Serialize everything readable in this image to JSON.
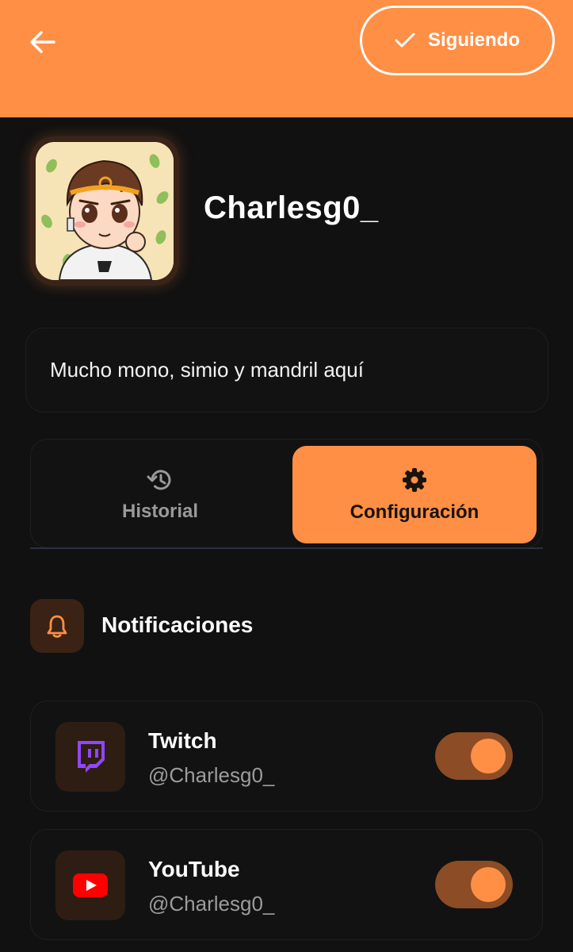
{
  "header": {
    "follow_label": "Siguiendo",
    "accent_color": "#ff8f45",
    "back_icon": "arrow-left-icon",
    "check_icon": "check-icon"
  },
  "profile": {
    "username": "Charlesg0_",
    "bio": "Mucho mono, simio y mandril aquí"
  },
  "tabs": [
    {
      "label": "Historial",
      "icon": "history-icon",
      "active": false
    },
    {
      "label": "Configuración",
      "icon": "gear-icon",
      "active": true
    }
  ],
  "notifications": {
    "title": "Notificaciones",
    "icon": "bell-icon",
    "items": [
      {
        "name": "Twitch",
        "handle": "@Charlesg0_",
        "icon": "twitch-icon",
        "brand_color": "#9146ff",
        "enabled": true
      },
      {
        "name": "YouTube",
        "handle": "@Charlesg0_",
        "icon": "youtube-icon",
        "brand_color": "#ff0000",
        "enabled": true
      }
    ]
  }
}
